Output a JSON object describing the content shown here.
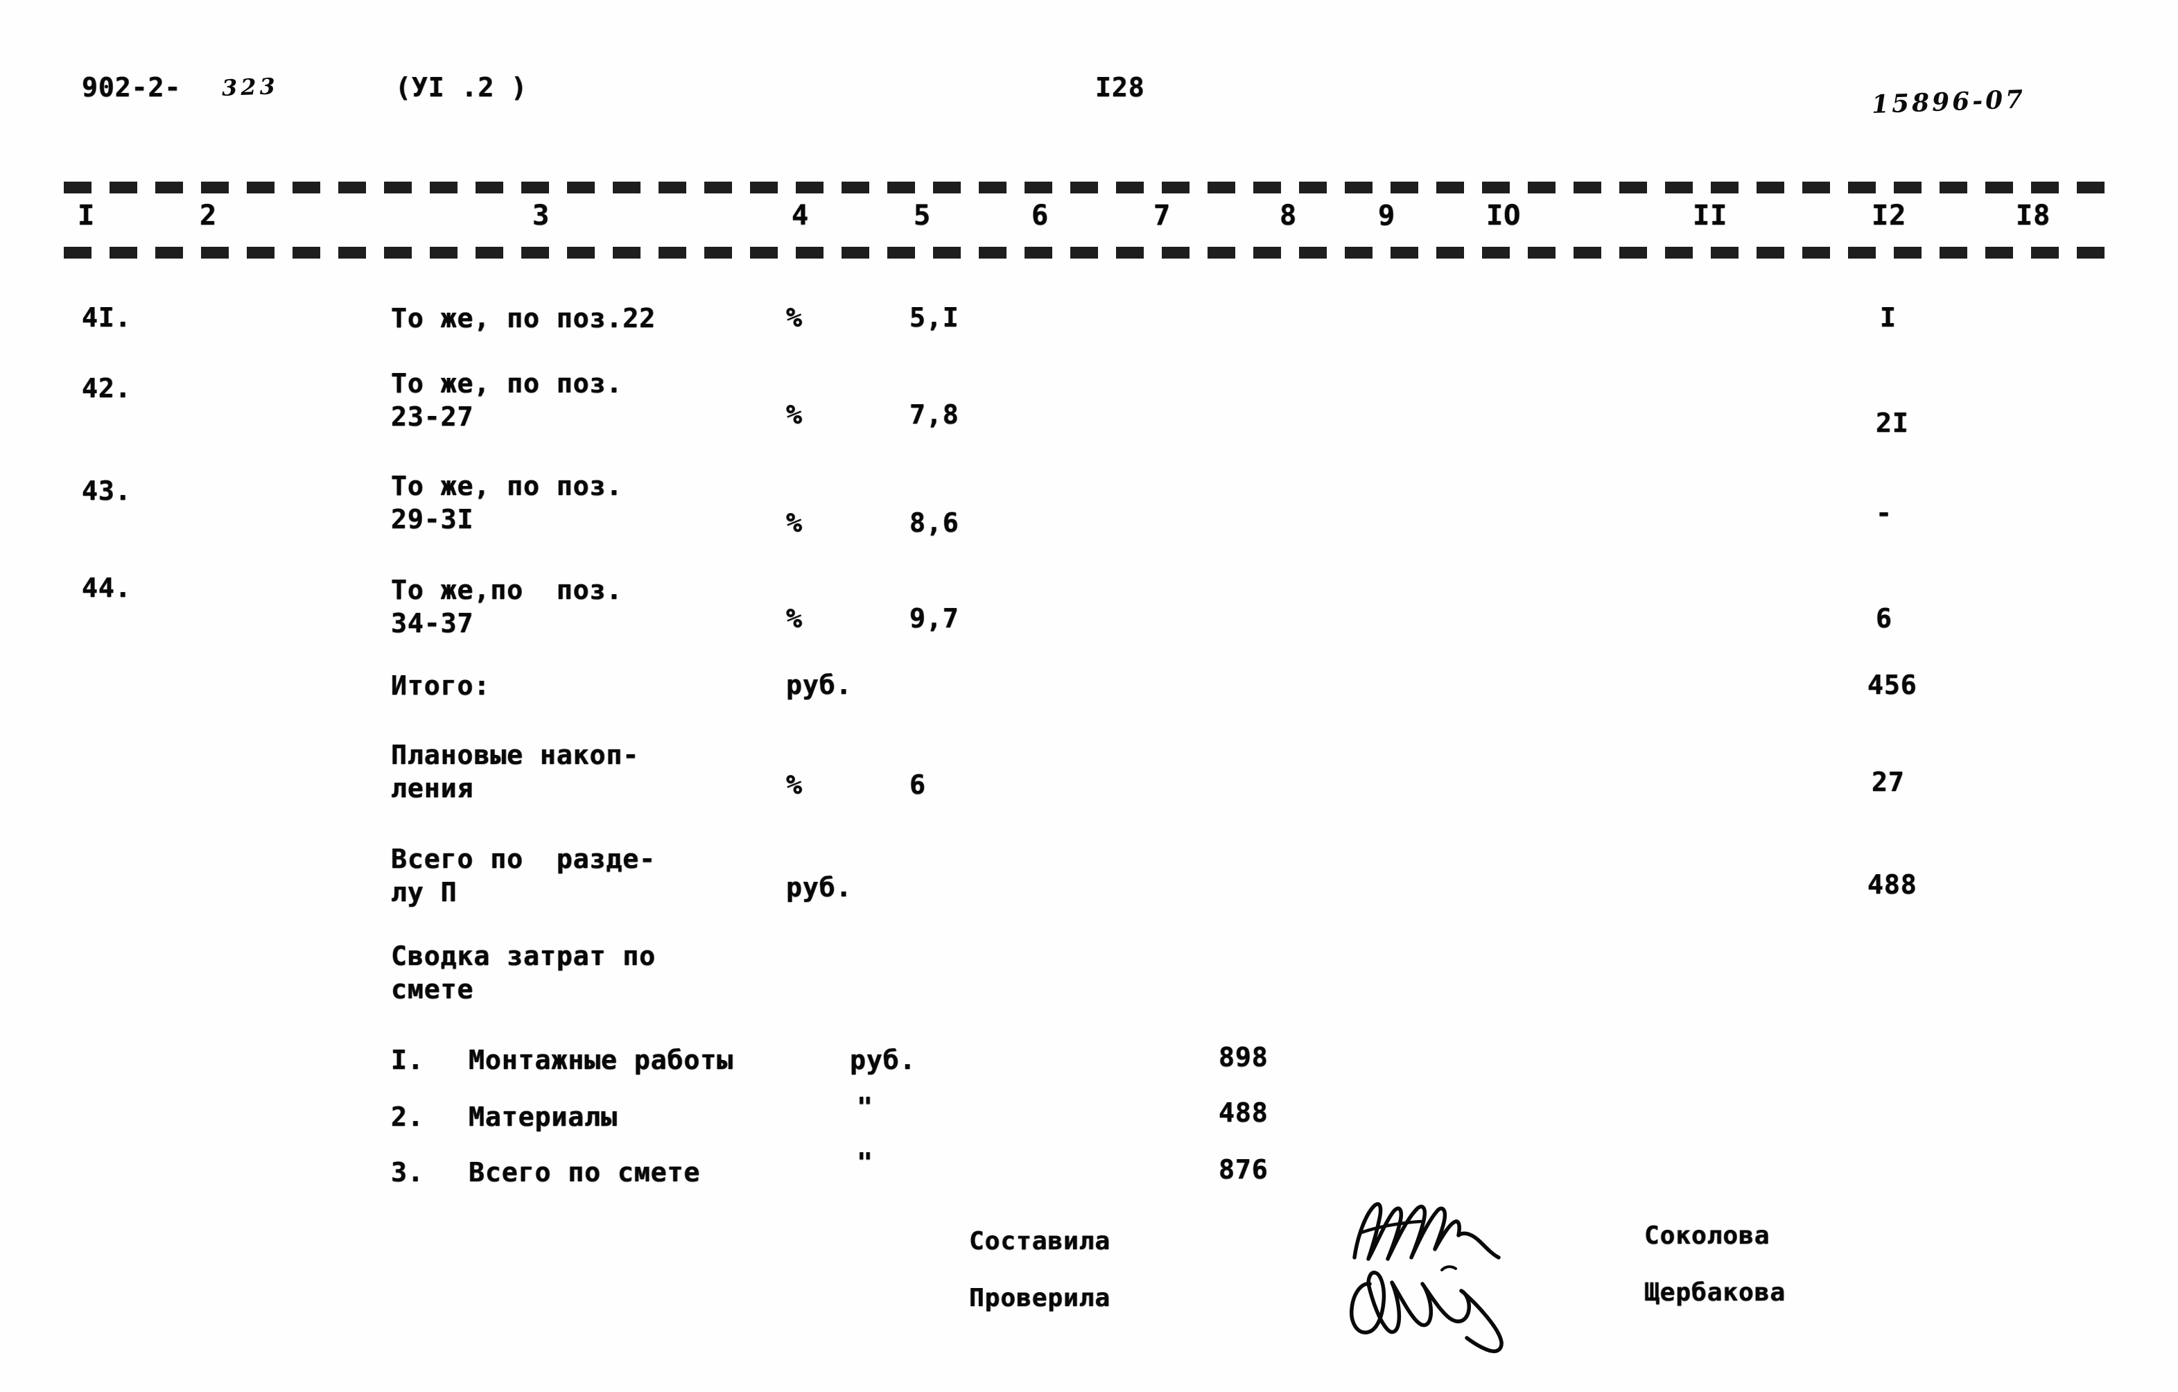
{
  "document": {
    "series_code": "902-2-",
    "series_code_handwritten": "323",
    "volume_label": "(УI .2 )",
    "page_number": "I28",
    "archive_number_handwritten": "15896-07"
  },
  "table": {
    "column_headers": [
      "I",
      "2",
      "3",
      "4",
      "5",
      "6",
      "7",
      "8",
      "9",
      "IO",
      "II",
      "I2",
      "I8"
    ],
    "rows": [
      {
        "no": "4I.",
        "description_lines": [
          "То же, по поз.22"
        ],
        "unit": "%",
        "value": "5,I",
        "col12": "I"
      },
      {
        "no": "42.",
        "description_lines": [
          "То же, по поз.",
          "23-27"
        ],
        "unit": "%",
        "value": "7,8",
        "col12": "2I"
      },
      {
        "no": "43.",
        "description_lines": [
          "То же, по поз.",
          "29-3I"
        ],
        "unit": "%",
        "value": "8,6",
        "col12": "-"
      },
      {
        "no": "44.",
        "description_lines": [
          "То же,по  поз.",
          "34-37"
        ],
        "unit": "%",
        "value": "9,7",
        "col12": "6"
      },
      {
        "no": "",
        "description_lines": [
          "Итого:"
        ],
        "unit": "руб.",
        "value": "",
        "col12": "456"
      },
      {
        "no": "",
        "description_lines": [
          "Плановые накоп-",
          "ления"
        ],
        "unit": "%",
        "value": "6",
        "col12": "27"
      },
      {
        "no": "",
        "description_lines": [
          "Всего по  разде-",
          "лу П"
        ],
        "unit": "руб.",
        "value": "",
        "col12": "488"
      }
    ]
  },
  "summary": {
    "title_lines": [
      "Сводка затрат по",
      "смете"
    ],
    "items": [
      {
        "no": "I.",
        "label": "Монтажные работы",
        "unit": "руб.",
        "amount": "898"
      },
      {
        "no": "2.",
        "label": "Материалы",
        "unit": "\"",
        "amount": "488"
      },
      {
        "no": "3.",
        "label": "Всего по смете",
        "unit": "\"",
        "amount": "876"
      }
    ]
  },
  "signatures": {
    "roles": [
      "Составила",
      "Проверила"
    ],
    "names": [
      "Соколова",
      "Щербакова"
    ]
  }
}
